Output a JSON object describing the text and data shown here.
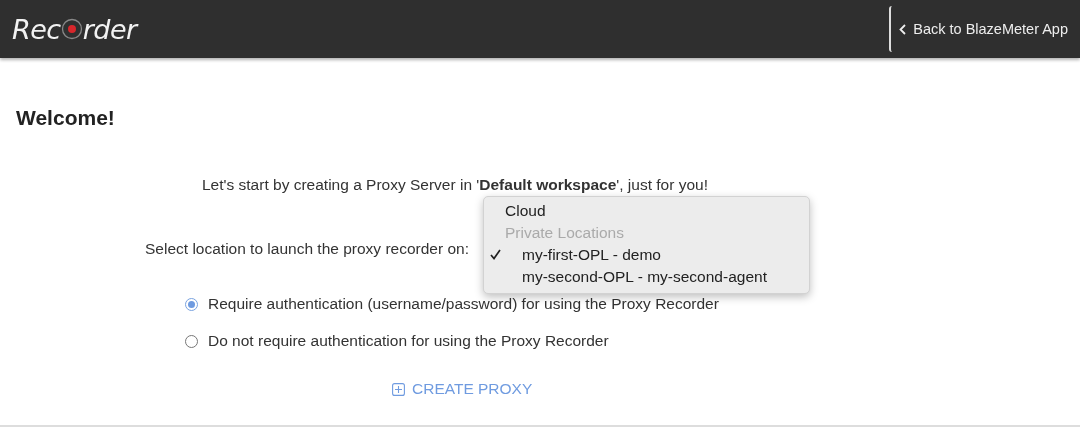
{
  "header": {
    "logo": [
      "Rec",
      "rder"
    ],
    "back_link": "Back to BlazeMeter App"
  },
  "title": "Welcome!",
  "intro": "Let's start by creating a Proxy Server in '**Default workspace**', just for you!",
  "location": {
    "label": "Select location to launch the proxy recorder on:",
    "menu": [
      {
        "kind": "option",
        "label": "Cloud",
        "selected": false
      },
      {
        "kind": "group",
        "label": "Private Locations",
        "children": [
          {
            "kind": "option",
            "label": "my-first-OPL - demo",
            "selected": true
          },
          {
            "kind": "option",
            "label": "my-second-OPL - my-second-agent",
            "selected": false
          }
        ]
      }
    ]
  },
  "auth_options": [
    {
      "label": "Require authentication (username/password) for using the Proxy Recorder",
      "selected": true
    },
    {
      "label": "Do not require authentication for using the Proxy Recorder",
      "selected": false
    }
  ],
  "create_button": "CREATE PROXY"
}
